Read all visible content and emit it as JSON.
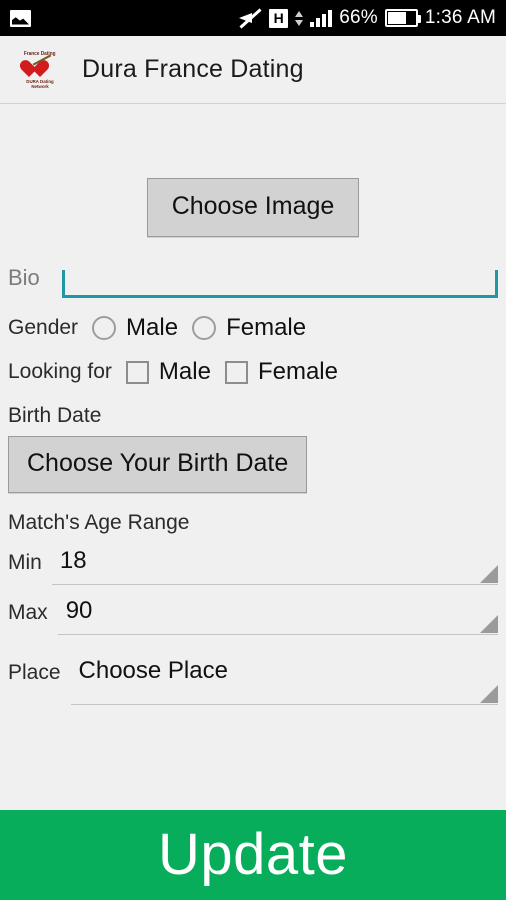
{
  "status_bar": {
    "notification_icon": "photo-icon",
    "mute_icon": "volume-muted-icon",
    "network_badge": "H",
    "data_transfer_icon": "data-up-down-icon",
    "signal_icon": "signal-bars-icon",
    "battery_percent": "66%",
    "battery_level": 66,
    "time": "1:36 AM",
    "background_color": "#000000",
    "foreground_color": "#ffffff"
  },
  "app_bar": {
    "title": "Dura France Dating",
    "logo": {
      "top_text": "France Dating",
      "bottom_line1": "DURA Dating",
      "bottom_line2": "Network",
      "icon": "heart-with-arrow-icon",
      "heart_color": "#d21b1b"
    },
    "background_color": "#f0f0f0"
  },
  "form": {
    "choose_image_label": "Choose Image",
    "bio": {
      "label": "Bio",
      "value": "",
      "placeholder": "",
      "underline_color": "#1f97a6"
    },
    "gender": {
      "label": "Gender",
      "options": [
        {
          "label": "Male",
          "checked": false
        },
        {
          "label": "Female",
          "checked": false
        }
      ]
    },
    "looking_for": {
      "label": "Looking for",
      "options": [
        {
          "label": "Male",
          "checked": false
        },
        {
          "label": "Female",
          "checked": false
        }
      ]
    },
    "birth_date": {
      "label": "Birth Date",
      "button_label": "Choose Your Birth Date"
    },
    "age_range": {
      "label": "Match's Age Range",
      "min": {
        "label": "Min",
        "value": "18"
      },
      "max": {
        "label": "Max",
        "value": "90"
      }
    },
    "place": {
      "label": "Place",
      "value": "Choose Place"
    },
    "background_color": "#f0f0f0"
  },
  "update_button": {
    "label": "Update",
    "background_color": "#07ad5b",
    "text_color": "#ffffff"
  }
}
